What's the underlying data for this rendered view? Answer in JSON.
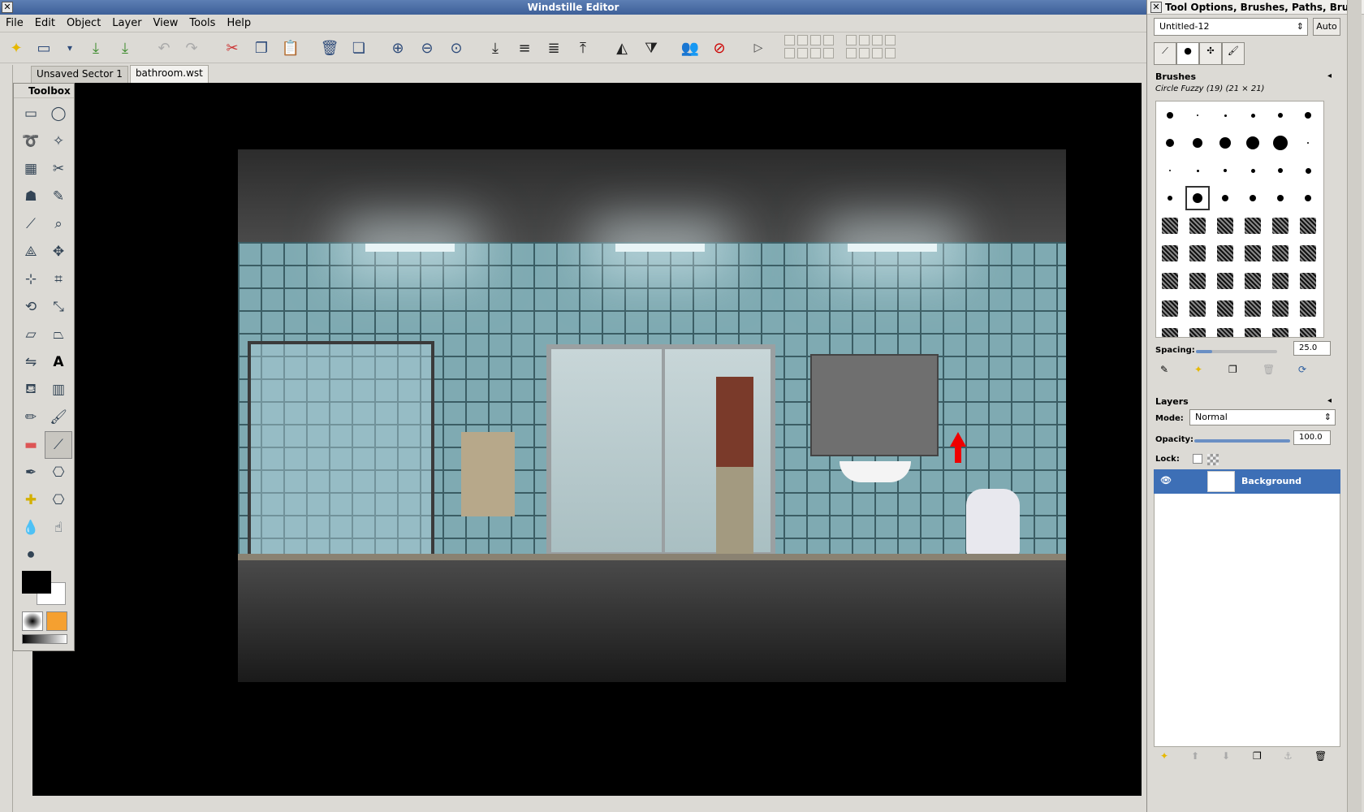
{
  "window": {
    "title": "Windstille Editor"
  },
  "menu": [
    "File",
    "Edit",
    "Object",
    "Layer",
    "View",
    "Tools",
    "Help"
  ],
  "toolbar_icons": [
    "new-file-icon",
    "open-file-icon",
    "dropdown-icon",
    "save-icon",
    "save-as-icon",
    "undo-icon",
    "redo-icon",
    "cut-icon",
    "copy-icon",
    "paste-icon",
    "delete-icon",
    "duplicate-icon",
    "zoom-in-icon",
    "zoom-out-icon",
    "zoom-reset-icon",
    "lower-to-bottom-icon",
    "lower-icon",
    "raise-icon",
    "raise-to-top-icon",
    "flip-horizontal-icon",
    "flip-vertical-icon",
    "persons-icon",
    "no-persons-icon",
    "play-icon"
  ],
  "tabs": [
    "Unsaved Sector 1",
    "bathroom.wst"
  ],
  "toolbox": {
    "title": "Toolbox",
    "tools": [
      "rect-select-icon",
      "ellipse-select-icon",
      "lasso-icon",
      "magic-wand-icon",
      "select-by-color-icon",
      "scissors-icon",
      "foreground-select-icon",
      "paths-icon",
      "color-picker-icon",
      "zoom-icon",
      "measure-icon",
      "move-icon",
      "align-icon",
      "crop-icon",
      "rotate-icon",
      "scale-icon",
      "shear-icon",
      "perspective-icon",
      "flip-icon",
      "text-icon",
      "bucket-fill-icon",
      "gradient-icon",
      "pencil-icon",
      "paintbrush-icon",
      "eraser-icon",
      "airbrush-icon",
      "ink-icon",
      "clone-icon",
      "heal-icon",
      "perspective-clone-icon",
      "blur-icon",
      "smudge-icon",
      "dodge-burn-icon"
    ]
  },
  "right_panel": {
    "title": "Tool Options, Brushes, Paths, Bru",
    "image_combo": "Untitled-12",
    "auto_button": "Auto",
    "brushes": {
      "label": "Brushes",
      "current": "Circle Fuzzy (19) (21 × 21)",
      "spacing_label": "Spacing:",
      "spacing_value": "25.0"
    },
    "layers": {
      "label": "Layers",
      "mode_label": "Mode:",
      "mode_value": "Normal",
      "opacity_label": "Opacity:",
      "opacity_value": "100.0",
      "lock_label": "Lock:",
      "layer_name": "Background"
    }
  },
  "colors": {
    "accent": "#3d6fb6",
    "title_bar": "#4a6ea8",
    "arrow": "#e00000"
  }
}
